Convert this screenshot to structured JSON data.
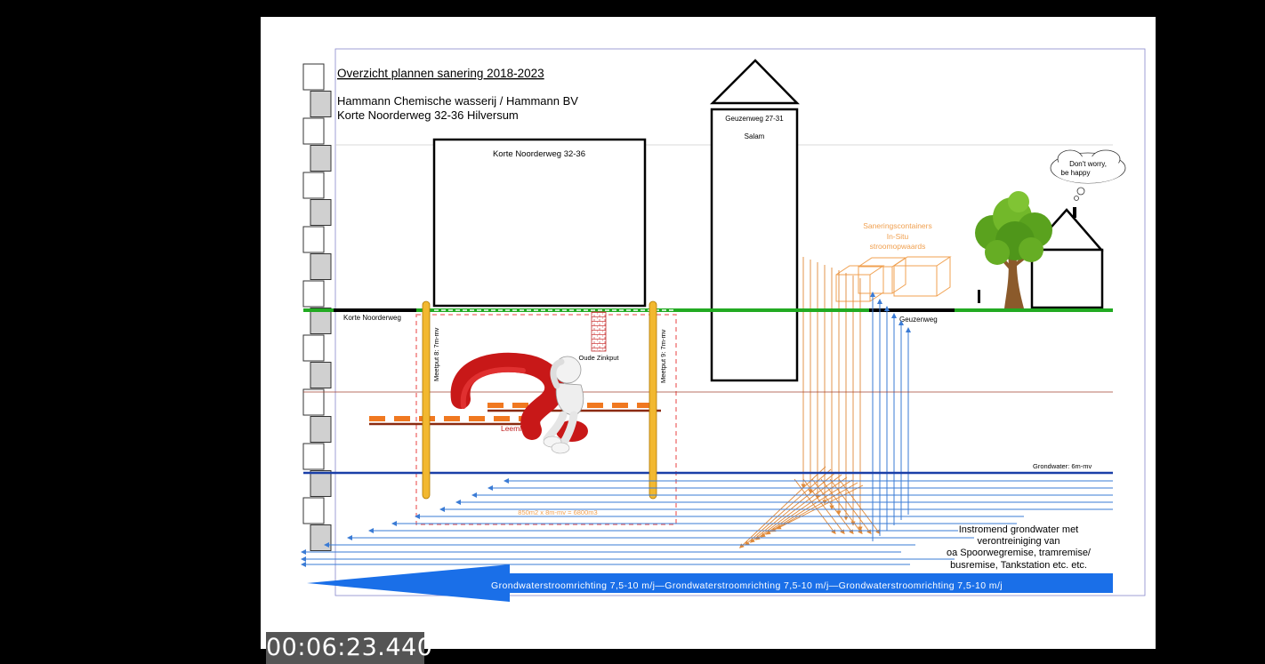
{
  "title": "Overzicht plannen sanering 2018-2023",
  "company": "Hammann Chemische wasserij / Hammann BV",
  "address": "Korte Noorderweg 32-36 Hilversum",
  "building_main_label": "Korte Noorderweg 32-36",
  "tower_label": "Geuzenweg 27-31",
  "tower_sublabel": "Salam",
  "street_left": "Korte Noorderweg",
  "street_right": "Geuzenweg",
  "well_8": "Meetput 8: 7m-mv",
  "well_9": "Meetput 9: 7m-mv",
  "zinc_pit": "Oude Zinkput",
  "clay_layers": "Leemlagen",
  "volume_note": "850m2 x 8m-mv = 6800m3",
  "containers": [
    "Saneringscontainers",
    "In-Situ",
    "stroomopwaards"
  ],
  "thought": [
    "Don't worry,",
    "be happy"
  ],
  "groundwater_label": "Grondwater: 6m-mv",
  "inflow_text": [
    "Instromend grondwater met",
    "verontreiniging van",
    "oa Spoorwegremise, tramremise/",
    "busremise, Tankstation etc. etc."
  ],
  "flow_direction": "Grondwaterstroomrichting 7,5-10 m/j—Grondwaterstroomrichting 7,5-10 m/j—Grondwaterstroomrichting 7,5-10 m/j",
  "timestamp": "00:06:23.440",
  "colors": {
    "orange": "#f0a050",
    "blue_line": "#3a7bd5",
    "flow_arrow": "#1a6fe8",
    "green_ground": "#22aa22",
    "yellow_well": "#f2b830",
    "red_question": "#c81818"
  }
}
